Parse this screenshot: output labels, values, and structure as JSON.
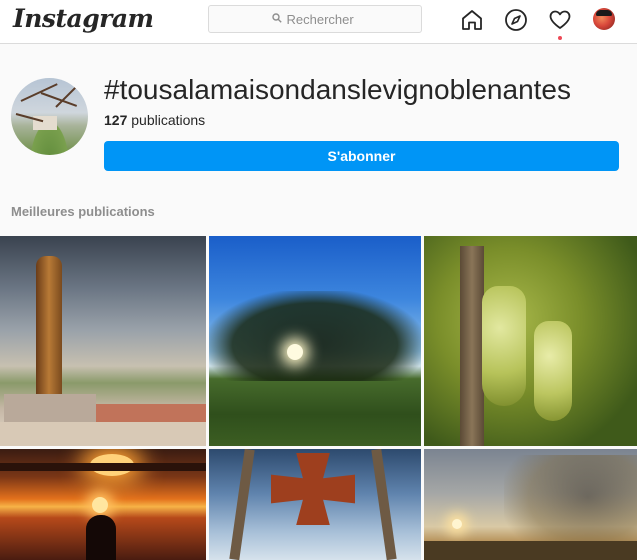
{
  "app": {
    "logo_text": "Instagram"
  },
  "search": {
    "placeholder": "Rechercher"
  },
  "nav": {
    "icons": [
      "home-icon",
      "explore-compass-icon",
      "activity-heart-icon",
      "profile-avatar"
    ],
    "notification_dot_color": "#ed4956"
  },
  "header": {
    "hashtag": "#tousalamaisondanslevignoblenantes",
    "post_count_number": "127",
    "post_count_label": " publications",
    "follow_label": "S'abonner"
  },
  "section": {
    "title": "Meilleures publications"
  },
  "colors": {
    "accent": "#0095f6",
    "text": "#262626",
    "muted": "#8e8e8e",
    "background": "#fafafa",
    "border": "#dbdbdb"
  }
}
